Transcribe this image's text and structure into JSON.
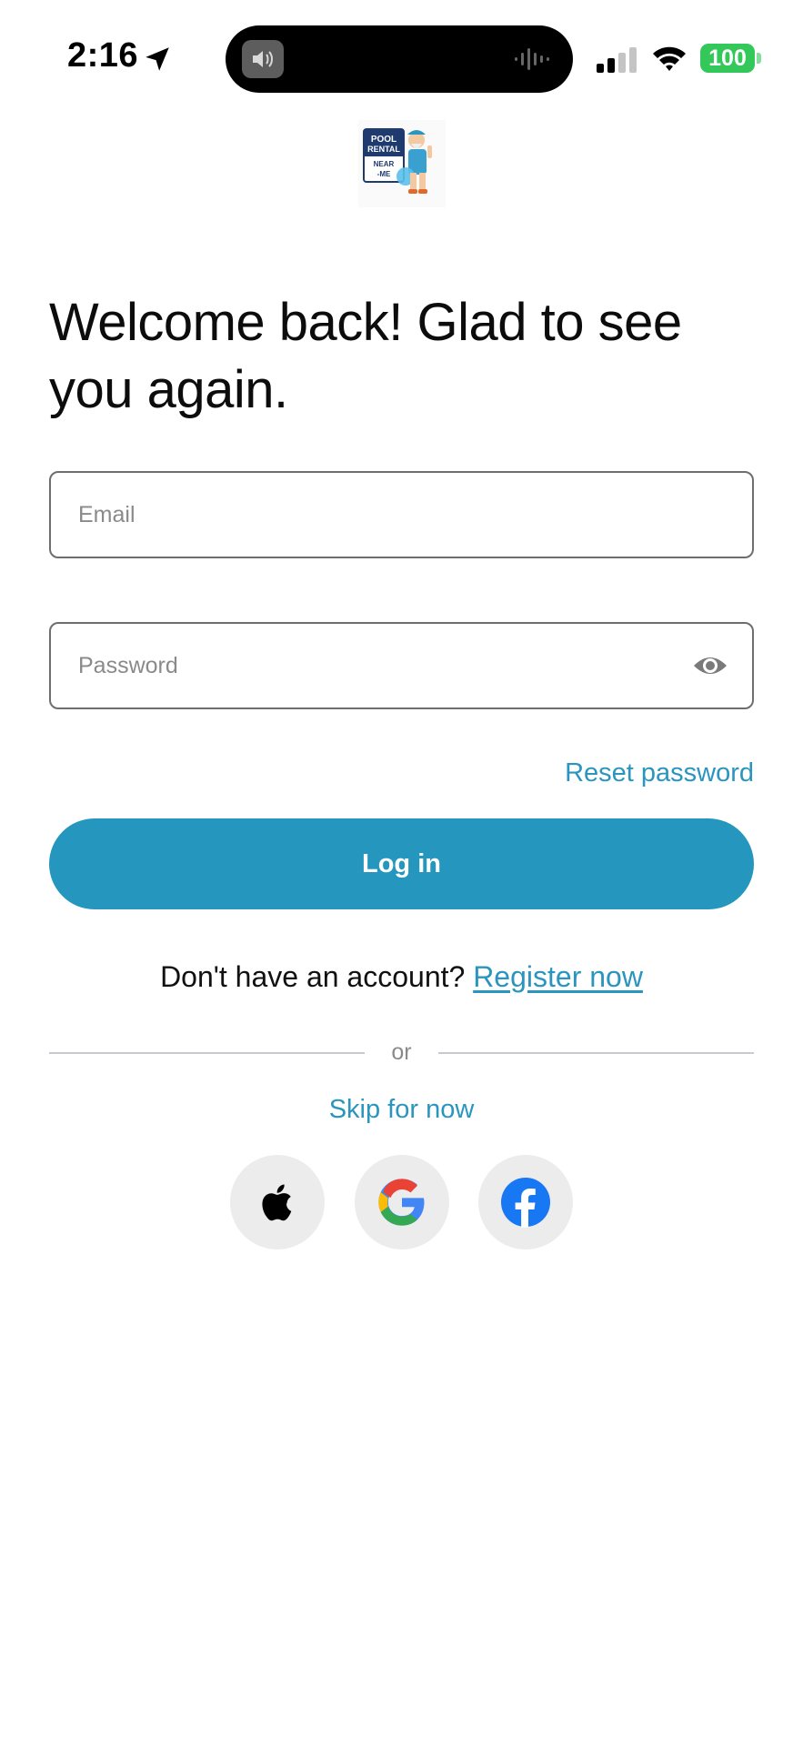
{
  "status_bar": {
    "time": "2:16",
    "battery": "100",
    "icons": [
      "location-arrow-icon",
      "speaker-icon",
      "audio-wave-icon",
      "signal-icon",
      "wifi-icon",
      "battery-icon"
    ]
  },
  "logo": {
    "text_lines": [
      "POOL",
      "RENTAL",
      "NEAR",
      "ME"
    ]
  },
  "heading": "Welcome back! Glad to see you again.",
  "form": {
    "email_placeholder": "Email",
    "password_placeholder": "Password",
    "password_toggle_icon": "eye-icon",
    "reset_label": "Reset password",
    "login_label": "Log in"
  },
  "register": {
    "prompt": "Don't have an account? ",
    "link": "Register now"
  },
  "divider_label": "or",
  "skip_label": "Skip for now",
  "social": [
    {
      "name": "Apple",
      "icon": "apple-icon"
    },
    {
      "name": "Google",
      "icon": "google-icon"
    },
    {
      "name": "Facebook",
      "icon": "facebook-icon"
    }
  ],
  "colors": {
    "accent": "#2596be",
    "link": "#2a95be",
    "battery": "#34c759",
    "social_bg": "#ececec",
    "facebook": "#1877f2"
  }
}
